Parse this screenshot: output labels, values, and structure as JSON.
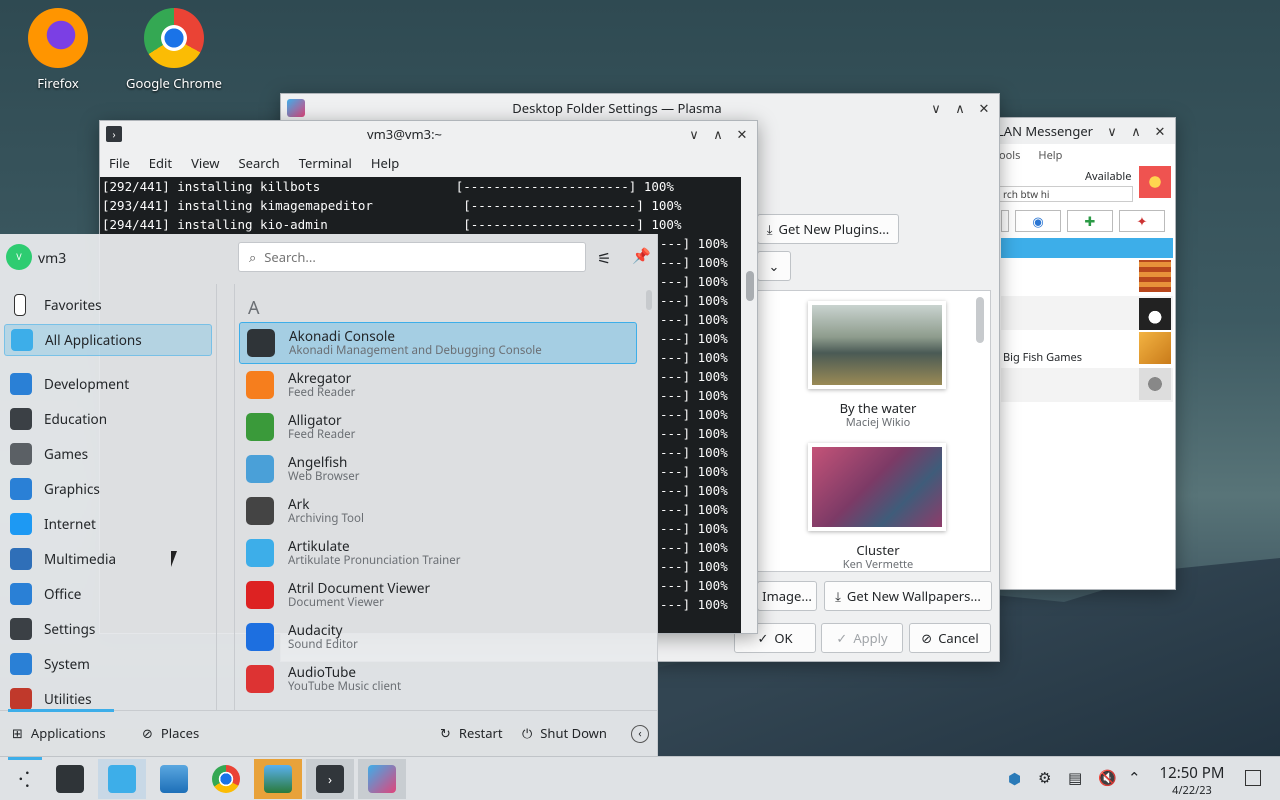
{
  "desktop": {
    "icons": [
      {
        "label": "Firefox"
      },
      {
        "label": "Google Chrome"
      }
    ]
  },
  "plasma_dialog": {
    "title": "Desktop Folder Settings — Plasma",
    "get_plugins": "Get New Plugins...",
    "wallpapers": [
      {
        "name": "By the water",
        "author": "Maciej Wikio"
      },
      {
        "name": "Cluster",
        "author": "Ken Vermette"
      }
    ],
    "add_image": "Image...",
    "get_wallpapers": "Get New Wallpapers...",
    "ok": "OK",
    "apply": "Apply",
    "cancel": "Cancel"
  },
  "lan": {
    "title": "LAN Messenger",
    "menu": [
      "ools",
      "Help"
    ],
    "status": "Available",
    "search": "rch btw hi",
    "contact": "Big Fish Games"
  },
  "terminal": {
    "title": "vm3@vm3:~",
    "menu": [
      "File",
      "Edit",
      "View",
      "Search",
      "Terminal",
      "Help"
    ],
    "lines": [
      "[292/441] installing killbots                  [----------------------] 100%",
      "[293/441] installing kimagemapeditor            [----------------------] 100%",
      "[294/441] installing kio-admin                  [----------------------] 100%"
    ],
    "tail": [
      "---] 100%",
      "---] 100%",
      "---] 100%",
      "---] 100%",
      "---] 100%",
      "---] 100%",
      "---] 100%",
      "---] 100%",
      "---] 100%",
      "---] 100%",
      "---] 100%",
      "---] 100%",
      "---] 100%",
      "---] 100%",
      "---] 100%",
      "---] 100%",
      "---] 100%",
      "---] 100%",
      "---] 100%",
      "---] 100%"
    ]
  },
  "launcher": {
    "user": "vm3",
    "avatar_letter": "V",
    "search_placeholder": "Search...",
    "section_letter": "A",
    "categories": [
      "Favorites",
      "All Applications",
      "Development",
      "Education",
      "Games",
      "Graphics",
      "Internet",
      "Multimedia",
      "Office",
      "Settings",
      "System",
      "Utilities"
    ],
    "apps": [
      {
        "name": "Akonadi Console",
        "desc": "Akonadi Management and Debugging Console"
      },
      {
        "name": "Akregator",
        "desc": "Feed Reader"
      },
      {
        "name": "Alligator",
        "desc": "Feed Reader"
      },
      {
        "name": "Angelfish",
        "desc": "Web Browser"
      },
      {
        "name": "Ark",
        "desc": "Archiving Tool"
      },
      {
        "name": "Artikulate",
        "desc": "Artikulate Pronunciation Trainer"
      },
      {
        "name": "Atril Document Viewer",
        "desc": "Document Viewer"
      },
      {
        "name": "Audacity",
        "desc": "Sound Editor"
      },
      {
        "name": "AudioTube",
        "desc": "YouTube Music client"
      }
    ],
    "footer": {
      "applications": "Applications",
      "places": "Places",
      "restart": "Restart",
      "shutdown": "Shut Down"
    }
  },
  "taskbar": {
    "time": "12:50 PM",
    "date": "4/22/23"
  }
}
